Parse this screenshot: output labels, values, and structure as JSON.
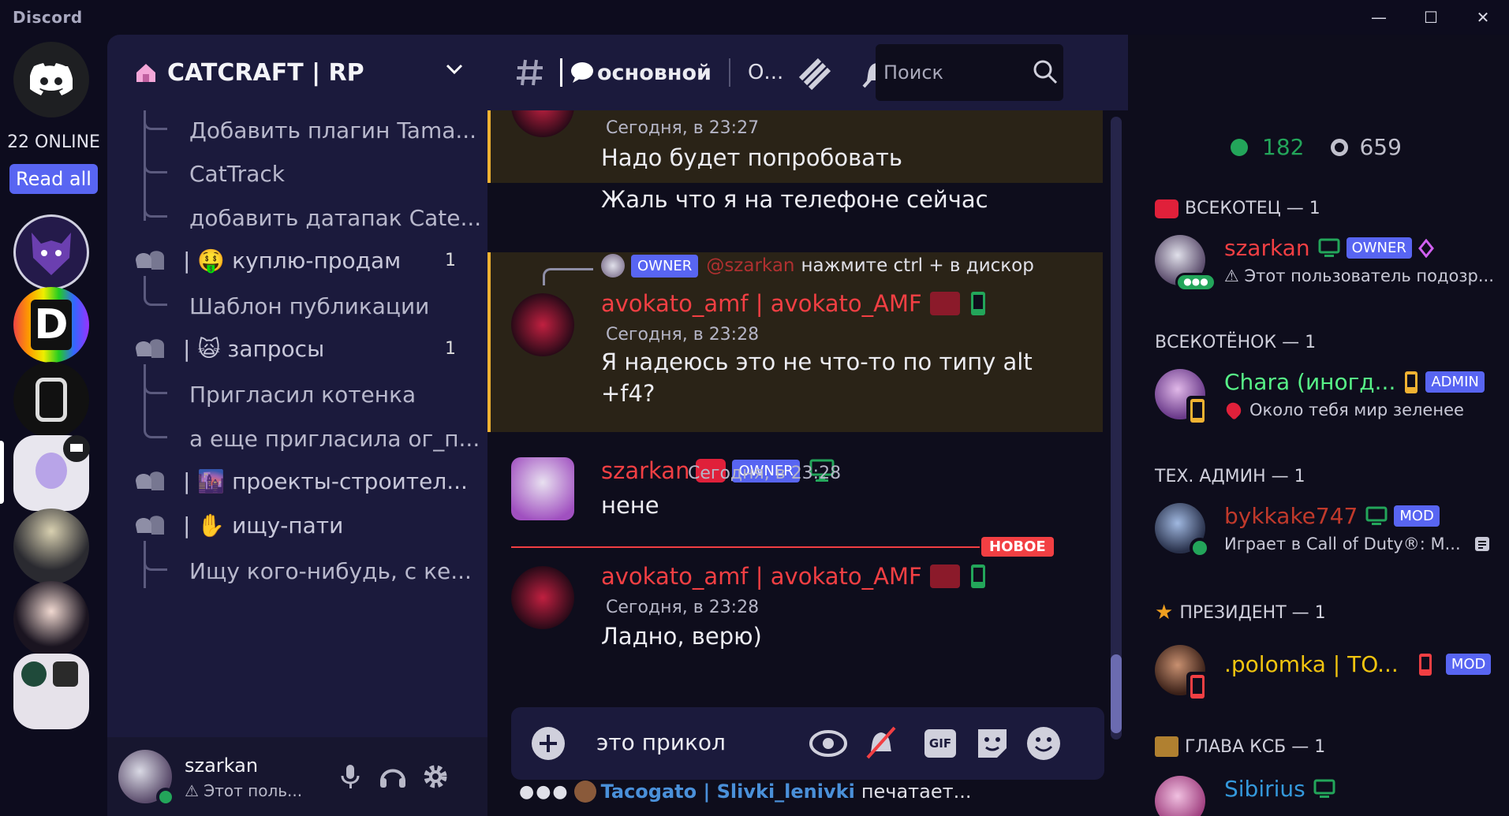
{
  "window": {
    "brand": "Discord",
    "controls": {
      "minimize": "—",
      "maximize": "☐",
      "close": "✕"
    }
  },
  "guild_bar": {
    "online_label": "22 ONLINE",
    "read_all_label": "Read all"
  },
  "server": {
    "name": "CATCRAFT | RP"
  },
  "channels": [
    {
      "type": "thread",
      "label": "Добавить плагин Tama..."
    },
    {
      "type": "thread",
      "label": "CatTrack"
    },
    {
      "type": "thread",
      "label": "добавить датапак Cate..."
    },
    {
      "type": "forum",
      "label": "| 🤑 куплю-продам",
      "count": "1"
    },
    {
      "type": "thread",
      "label": "Шаблон публикации"
    },
    {
      "type": "forum",
      "label": "| 🙀 запросы",
      "count": "1"
    },
    {
      "type": "thread",
      "label": "Пригласил котенка"
    },
    {
      "type": "thread",
      "label": "а еще пригласила ог_п..."
    },
    {
      "type": "forum",
      "label": "| 🌆 проекты-строител..."
    },
    {
      "type": "forum",
      "label": "| ✋ ищу-пати"
    },
    {
      "type": "thread",
      "label": "Ищу кого-нибудь, с ке..."
    }
  ],
  "user_panel": {
    "username": "szarkan",
    "status": "⚠ Этот поль..."
  },
  "chat_header": {
    "channel_name": "основной",
    "topic": "О...",
    "search_placeholder": "Поиск"
  },
  "messages": {
    "m1": {
      "timestamp": "Сегодня, в 23:27",
      "line1": "Надо будет попробовать",
      "line2": "Жаль что я на телефоне сейчас"
    },
    "m2": {
      "reply_tag": "OWNER",
      "reply_mention": "@szarkan",
      "reply_text": "нажмите ctrl + в дискор",
      "author": "avokato_amf | avokato_AMF",
      "timestamp": "Сегодня, в 23:28",
      "line1": "Я надеюсь это не что-то по типу alt",
      "line2": "+f4?"
    },
    "m3": {
      "author": "szarkan",
      "tag": "OWNER",
      "timestamp": "Сегодня, в 23:28",
      "text": "нене"
    },
    "new_divider": "НОВОЕ",
    "m4": {
      "author": "avokato_amf | avokato_AMF",
      "timestamp": "Сегодня, в 23:28",
      "text": "Ладно, верю)"
    }
  },
  "composer": {
    "value": "это прикол",
    "gif_label": "GIF"
  },
  "typing": {
    "who": "Tacogato | Slivki_lenivki",
    "suffix": "печатает..."
  },
  "members": {
    "online_count": "182",
    "total_count": "659",
    "groups": [
      {
        "header": "ВСЕКОТЕЦ — 1",
        "name": "szarkan",
        "tag": "OWNER",
        "activity": "⚠ Этот пользователь подозр...",
        "name_color": "#f23f43"
      },
      {
        "header": "ВСЕКОТЁНОК — 1",
        "name": "Chara (иногд...",
        "tag": "ADMIN",
        "activity": "Около тебя мир зеленее",
        "name_color": "#57f287"
      },
      {
        "header": "ТЕХ. АДМИН — 1",
        "name": "bykkake747",
        "tag": "MOD",
        "activity": "Играет в Call of Duty®: M...",
        "name_color": "#c0392b"
      },
      {
        "header": "ПРЕЗИДЕНТ — 1",
        "name": ".polomka | TO...",
        "tag": "MOD",
        "activity": "",
        "name_color": "#f1c40f"
      },
      {
        "header": "ГЛАВА КСБ — 1",
        "name": "Sibirius",
        "tag": "",
        "activity": "",
        "name_color": "#3498db"
      }
    ]
  },
  "colors": {
    "accent": "#5865f2",
    "online": "#23a55a",
    "mention_highlight": "#f0b232",
    "new_divider": "#f23f43",
    "avokato_name": "#f23f43",
    "szarkan_name": "#f23f43"
  }
}
